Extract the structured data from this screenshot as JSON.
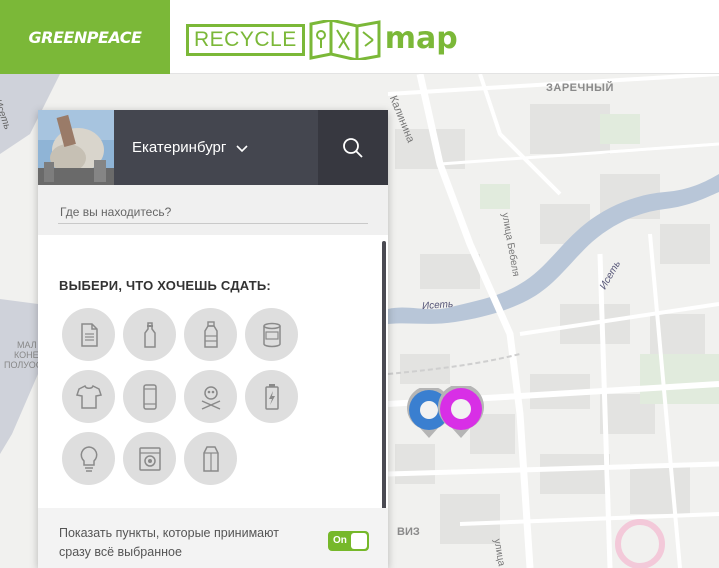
{
  "header": {
    "greenpeace_logo": "GREENPEACE",
    "recycle_word": "RECYCLE",
    "map_word": "map",
    "brand_color": "#7bb838"
  },
  "map": {
    "labels": {
      "zarechny": "ЗАРЕЧНЫЙ",
      "kalinina": "Калинина",
      "iset_top": "Исеть",
      "iset_right": "Исеть",
      "iset_mid": "Исеть",
      "bebelya": "улица Бебеля",
      "viz": "ВИЗ",
      "left_1": "МАЛ",
      "left_2": "КОНЕ",
      "left_3": "ПОЛУОС",
      "bottom_street": "улица"
    },
    "pins": [
      {
        "name": "blue",
        "color": "#3a7fd0"
      },
      {
        "name": "magenta",
        "color": "#d82fe6"
      }
    ]
  },
  "panel": {
    "city": "Екатеринбург",
    "location_placeholder": "Где вы находитесь?",
    "choose_title": "ВЫБЕРИ, ЧТО ХОЧЕШЬ СДАТЬ:",
    "categories": [
      {
        "icon": "paper-icon"
      },
      {
        "icon": "glass-bottle-icon"
      },
      {
        "icon": "plastic-bottle-icon"
      },
      {
        "icon": "tin-can-icon"
      },
      {
        "icon": "clothes-icon"
      },
      {
        "icon": "phone-icon"
      },
      {
        "icon": "hazardous-icon"
      },
      {
        "icon": "battery-icon"
      },
      {
        "icon": "lightbulb-icon"
      },
      {
        "icon": "appliance-icon"
      },
      {
        "icon": "tetrapak-icon"
      }
    ],
    "toggle_text": "Показать пункты, которые принимают сразу всё выбранное",
    "toggle_label": "On",
    "toggle_color": "#76b82a"
  }
}
